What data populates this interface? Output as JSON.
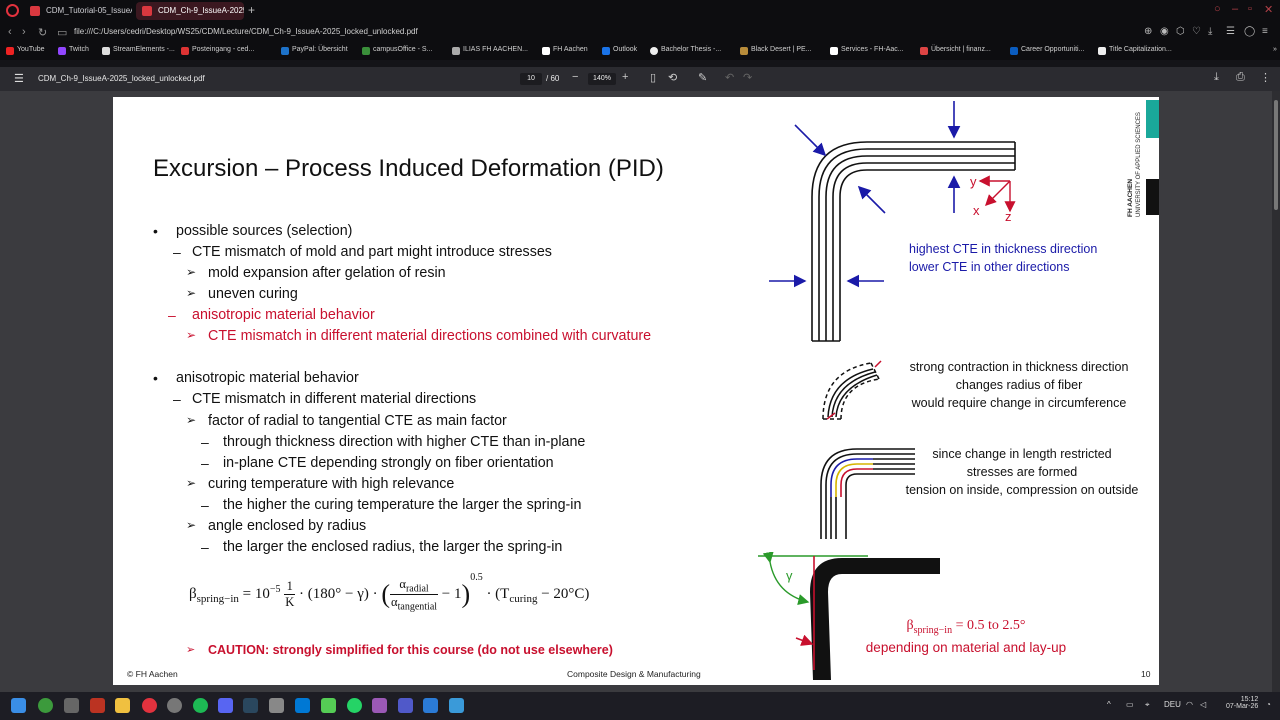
{
  "browser": {
    "tabs": [
      {
        "label": "CDM_Tutorial-05_IssueA"
      },
      {
        "label": "CDM_Ch-9_IssueA-2025..."
      }
    ],
    "url": "file:///C:/Users/cedri/Desktop/WS25/CDM/Lecture/CDM_Ch-9_IssueA-2025_locked_unlocked.pdf",
    "bookmarks": [
      "YouTube",
      "Twitch",
      "StreamElements -...",
      "Posteingang - ced...",
      "PayPal: Übersicht",
      "campusOffice - S...",
      "ILIAS FH AACHEN...",
      "FH Aachen",
      "Outlook",
      "Bachelor Thesis -...",
      "Black Desert | PE...",
      "Services - FH-Aac...",
      "Übersicht | finanz...",
      "Career Opportuniti...",
      "Title Capitalization..."
    ]
  },
  "pdf_toolbar": {
    "filename": "CDM_Ch-9_IssueA-2025_locked_unlocked.pdf",
    "page_current": "10",
    "page_total": "/ 60",
    "zoom": "140%"
  },
  "slide": {
    "title": "Excursion – Process Induced Deformation (PID)",
    "bullets": {
      "b1": "possible sources (selection)",
      "b1_1": "CTE mismatch of mold and part might introduce stresses",
      "b1_1_1": "mold expansion after gelation of resin",
      "b1_1_2": "uneven curing",
      "b1_2": "anisotropic material behavior",
      "b1_2_1": "CTE mismatch in different material directions combined with curvature",
      "b2": "anisotropic material behavior",
      "b2_1": "CTE mismatch in different material directions",
      "b2_1_1": "factor of radial to tangential CTE as main factor",
      "b2_1_1_1": "through thickness direction with higher CTE than in-plane",
      "b2_1_1_2": "in-plane CTE depending strongly on fiber orientation",
      "b2_1_2": "curing temperature with high relevance",
      "b2_1_2_1": "the higher the curing temperature the larger the spring-in",
      "b2_1_3": "angle enclosed by radius",
      "b2_1_3_1": "the larger the enclosed radius, the larger the spring-in"
    },
    "formula": {
      "beta": "β",
      "beta_sub": "spring−in",
      "eq": "= 10",
      "exp": "−5",
      "one": "1",
      "k": "K",
      "angle": "· (180° − γ) ·",
      "alpha_r": "α",
      "alpha_r_sub": "radial",
      "alpha_t": "α",
      "alpha_t_sub": "tangential",
      "minus1": "− 1",
      "pow": "0.5",
      "tcure": "· (T",
      "tcure_sub": "curing",
      "tcure_end": " − 20°C)"
    },
    "caution": "CAUTION: strongly simplified for this course (do not use elsewhere)",
    "footer_left": "© FH Aachen",
    "footer_center": "Composite Design & Manufacturing",
    "page_number": "10",
    "captions": {
      "c1_l1": "highest CTE in thickness direction",
      "c1_l2": "lower CTE in other directions",
      "c2_l1": "strong contraction in thickness direction",
      "c2_l2": "changes radius of fiber",
      "c2_l3": "would require change in circumference",
      "c3_l1": "since change in length restricted",
      "c3_l2": "stresses are formed",
      "c3_l3": "tension on inside, compression on outside",
      "c4_l1_beta": "β",
      "c4_l1_sub": "spring−in",
      "c4_l1_rest": " = 0.5 to 2.5°",
      "c4_l2": "depending on material and lay-up",
      "axis_x": "x",
      "axis_y": "y",
      "axis_z": "z",
      "gamma": "γ"
    },
    "logo_lines": [
      "FH AACHEN",
      "UNIVERSITY OF APPLIED SCIENCES"
    ]
  },
  "taskbar": {
    "lang": "DEU",
    "time": "15:12",
    "date": "07-Mar-26"
  },
  "colors": {
    "accent_red": "#c8102e",
    "caption_blue": "#1a1aa8",
    "teal": "#1aa89a"
  }
}
